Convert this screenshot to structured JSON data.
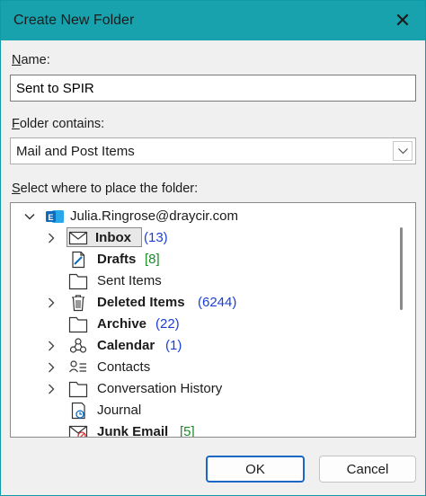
{
  "window": {
    "title": "Create New Folder",
    "close_glyph": "✕"
  },
  "name_field": {
    "label_key": "N",
    "label_rest": "ame:",
    "value": "Sent to SPIR"
  },
  "contains_field": {
    "label_key": "F",
    "label_rest": "older contains:",
    "value": "Mail and Post Items"
  },
  "tree": {
    "label_key": "S",
    "label_rest": "elect where to place the folder:",
    "account": "Julia.Ringrose@draycir.com",
    "items": [
      {
        "name": "Inbox",
        "count": "(13)",
        "count_color": "blue",
        "bold": true,
        "has_children": true,
        "selected": true,
        "icon": "inbox-icon"
      },
      {
        "name": "Drafts",
        "count": "[8]",
        "count_color": "green",
        "bold": true,
        "has_children": false,
        "selected": false,
        "icon": "drafts-icon"
      },
      {
        "name": "Sent Items",
        "count": "",
        "count_color": "",
        "bold": false,
        "has_children": false,
        "selected": false,
        "icon": "folder-icon"
      },
      {
        "name": "Deleted Items",
        "count": "(6244)",
        "count_color": "blue",
        "bold": true,
        "has_children": true,
        "selected": false,
        "icon": "trash-icon"
      },
      {
        "name": "Archive",
        "count": "(22)",
        "count_color": "blue",
        "bold": true,
        "has_children": false,
        "selected": false,
        "icon": "folder-icon"
      },
      {
        "name": "Calendar",
        "count": "(1)",
        "count_color": "blue",
        "bold": true,
        "has_children": true,
        "selected": false,
        "icon": "calendar-icon"
      },
      {
        "name": "Contacts",
        "count": "",
        "count_color": "",
        "bold": false,
        "has_children": true,
        "selected": false,
        "icon": "contacts-icon"
      },
      {
        "name": "Conversation History",
        "count": "",
        "count_color": "",
        "bold": false,
        "has_children": true,
        "selected": false,
        "icon": "folder-icon"
      },
      {
        "name": "Journal",
        "count": "",
        "count_color": "",
        "bold": false,
        "has_children": false,
        "selected": false,
        "icon": "journal-icon"
      },
      {
        "name": "Junk Email",
        "count": "[5]",
        "count_color": "green",
        "bold": true,
        "has_children": false,
        "selected": false,
        "icon": "junk-email-icon"
      }
    ]
  },
  "buttons": {
    "ok": "OK",
    "cancel": "Cancel"
  },
  "colors": {
    "titlebar": "#18a2ad",
    "accent": "#1d67c4",
    "count_blue": "#1a3fd6",
    "count_green": "#1d8a2a",
    "outlook_blue": "#0f6cbd"
  }
}
